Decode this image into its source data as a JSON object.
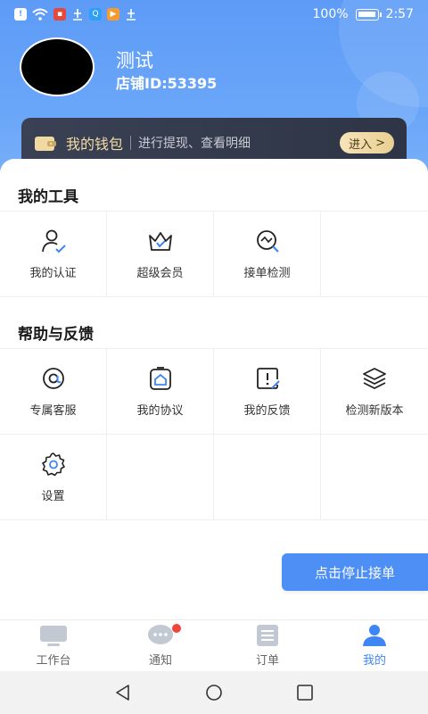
{
  "status_bar": {
    "battery": "100%",
    "time": "2:57",
    "icons": [
      "alert-icon",
      "wifi-icon",
      "app-icon",
      "usb-icon",
      "search-app-icon",
      "video-app-icon",
      "usb-debug-icon"
    ]
  },
  "profile": {
    "name": "测试",
    "store_id": "店铺ID:53395"
  },
  "wallet": {
    "title": "我的钱包",
    "description": "进行提现、查看明细",
    "enter_label": "进入"
  },
  "tools": {
    "title": "我的工具",
    "items": [
      {
        "label": "我的认证",
        "icon": "verify-user-icon"
      },
      {
        "label": "超级会员",
        "icon": "crown-icon"
      },
      {
        "label": "接单检测",
        "icon": "chart-search-icon"
      }
    ]
  },
  "help": {
    "title": "帮助与反馈",
    "items": [
      {
        "label": "专属客服",
        "icon": "at-icon"
      },
      {
        "label": "我的协议",
        "icon": "protocol-icon"
      },
      {
        "label": "我的反馈",
        "icon": "feedback-icon"
      },
      {
        "label": "检测新版本",
        "icon": "layers-icon"
      },
      {
        "label": "设置",
        "icon": "gear-icon"
      }
    ]
  },
  "stop_button": "点击停止接单",
  "tabbar": {
    "tabs": [
      {
        "label": "工作台",
        "icon": "monitor-icon"
      },
      {
        "label": "通知",
        "icon": "chat-icon"
      },
      {
        "label": "订单",
        "icon": "list-icon"
      },
      {
        "label": "我的",
        "icon": "person-icon"
      }
    ]
  },
  "colors": {
    "primary": "#4d8ff5",
    "header": "#5d9bf7",
    "wallet_bg": "#333a4c",
    "wallet_gold": "#f3dca6",
    "badge": "#f0443f"
  }
}
